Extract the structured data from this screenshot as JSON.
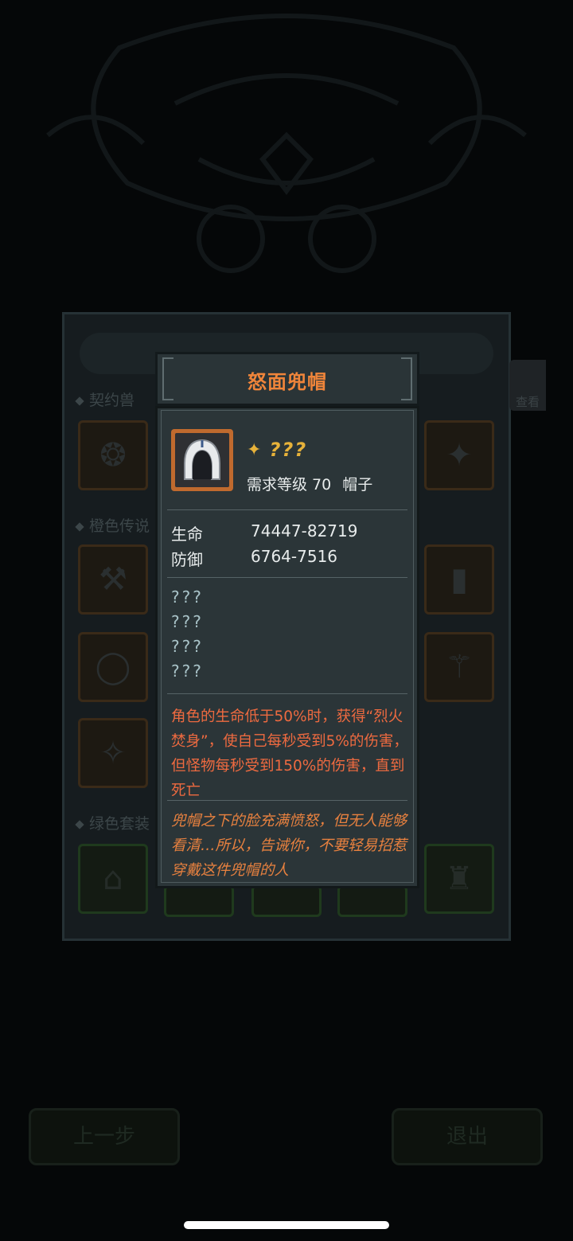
{
  "background": {
    "section_contract_beast": "契约兽",
    "section_orange_legend": "橙色传说",
    "section_green_set": "绿色套装",
    "view_button": "查看",
    "prev_button": "上一步",
    "exit_button": "退出"
  },
  "popup": {
    "title": "怒面兜帽",
    "rarity": "???",
    "required_level_label": "需求等级 70",
    "item_type": "帽子",
    "stats": [
      {
        "name": "生命",
        "value": "74447-82719"
      },
      {
        "name": "防御",
        "value": "6764-7516"
      }
    ],
    "unknown_attributes": [
      "???",
      "???",
      "???",
      "???"
    ],
    "effect_text": "角色的生命低于50%时，获得“烈火焚身”，使自己每秒受到5%的伤害，但怪物每秒受到150%的伤害，直到死亡",
    "flavor_text": "兜帽之下的脸充满愤怒，但无人能够看清…所以，告诫你，不要轻易招惹穿戴这件兜帽的人"
  },
  "colors": {
    "title_orange": "#f0853a",
    "rarity_gold": "#e7b23a",
    "effect_red": "#ee6a40",
    "flavor_orange": "#e8813f",
    "panel_bg": "#2b3538",
    "item_frame_orange": "#c06a2e"
  },
  "icons": {
    "item": "hood-icon",
    "rarity": "rarity-sparkle-icon"
  }
}
